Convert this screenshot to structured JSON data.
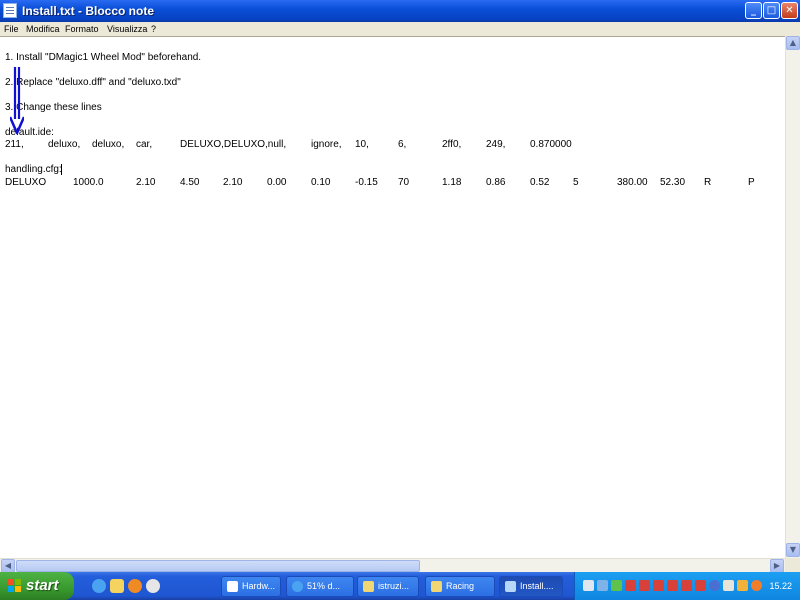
{
  "window": {
    "title": "Install.txt - Blocco note",
    "minimize_glyph": "_",
    "maximize_glyph": "□",
    "close_glyph": "✕"
  },
  "menu": [
    "File",
    "Modifica",
    "Formato",
    "Visualizza",
    "?"
  ],
  "content": {
    "lines": [
      "1. Install \"DMagic1 Wheel Mod\" beforehand.",
      "2. Replace \"deluxo.dff\" and \"deluxo.txd\"",
      "3. Change these lines",
      "default.ide:",
      "handling.cfg:"
    ],
    "ide_values": [
      "211,",
      "deluxo,",
      "deluxo,",
      "car,",
      "DELUXO,DELUXO,null,",
      "ignore,",
      "10,",
      "6,",
      "2ff0,",
      "249,",
      "0.870000"
    ],
    "handling_values": [
      "DELUXO",
      "1000.0",
      "2.10",
      "4.50",
      "2.10",
      "0.00",
      "0.10",
      "-0.15",
      "70",
      "1.18",
      "0.86",
      "0.52",
      "5",
      "380.00",
      "52.30",
      "R",
      "P"
    ],
    "arrow_color": "#1010d0"
  },
  "scrollbars": {
    "up_glyph": "▲",
    "down_glyph": "▼",
    "left_glyph": "◀",
    "right_glyph": "▶"
  },
  "taskbar": {
    "start_label": "start",
    "quick_launch_icons": [
      "internet-explorer-icon",
      "media-icon",
      "messenger-icon",
      "player-icon"
    ],
    "buttons": [
      {
        "label": "Hardw...",
        "icon": "document-icon",
        "color": "#ffffff",
        "active": false
      },
      {
        "label": "51% d...",
        "icon": "internet-explorer-icon",
        "color": "#4aa3f0",
        "active": false
      },
      {
        "label": "istruzi...",
        "icon": "folder-icon",
        "color": "#f1d774",
        "active": false
      },
      {
        "label": "Racing",
        "icon": "folder-icon",
        "color": "#f1d774",
        "active": false
      },
      {
        "label": "Install....",
        "icon": "notepad-icon",
        "color": "#b6d7f7",
        "active": true
      }
    ],
    "clock": "15.22"
  }
}
